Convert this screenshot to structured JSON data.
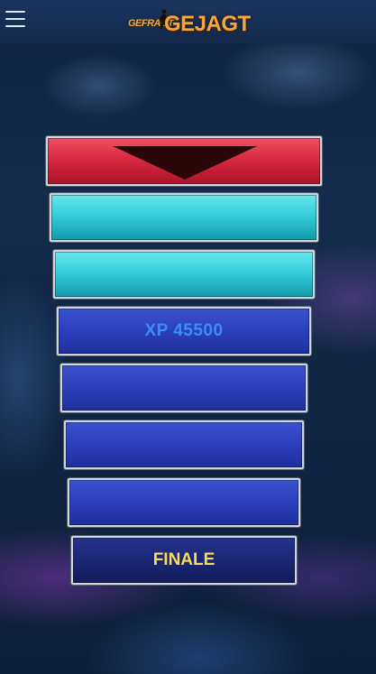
{
  "header": {
    "menu_icon": "hamburger-menu-icon",
    "logo_text_small": "GEFRAGT",
    "logo_text_big": "GEJAGT"
  },
  "ladder": {
    "chaser_marker_icon": "down-triangle-icon",
    "prize_label": "XP 45500",
    "finale_label": "FINALE"
  },
  "colors": {
    "chaser": "#d82a40",
    "player_path": "#34ced9",
    "step": "#2a3fba",
    "finale_bg": "#1b2675",
    "prize_text": "#3a8ef2",
    "finale_text": "#f7dc5a"
  }
}
